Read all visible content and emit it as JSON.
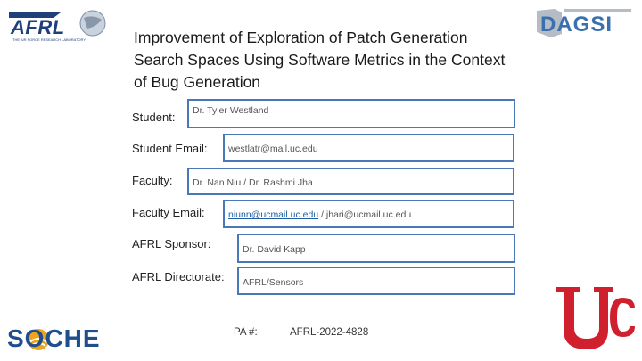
{
  "title": "Improvement of Exploration of Patch Generation Search Spaces Using Software Metrics in the Context of Bug Generation",
  "logos": {
    "afrl": "AFRL",
    "afrl_tagline": "THE AIR FORCE RESEARCH LABORATORY",
    "dagsi": "DAGSI",
    "soche": "SOCHE"
  },
  "fields": {
    "student_label": "Student:",
    "student_value": "Dr. Tyler Westland",
    "student_email_label": "Student Email:",
    "student_email_value": "westlatr@mail.uc.edu",
    "faculty_label": "Faculty:",
    "faculty_value": "Dr. Nan Niu / Dr. Rashmi Jha",
    "faculty_email_label": "Faculty Email:",
    "faculty_email_link": "niunn@ucmail.uc.edu",
    "faculty_email_rest": " / jhari@ucmail.uc.edu",
    "sponsor_label": "AFRL Sponsor:",
    "sponsor_value": "Dr. David Kapp",
    "directorate_label": "AFRL Directorate:",
    "directorate_value": "AFRL/Sensors"
  },
  "pa": {
    "label": "PA #:",
    "value": "AFRL-2022-4828"
  },
  "colors": {
    "box_border": "#4a77b8",
    "link": "#1f5fa8",
    "uc_red": "#d0202e",
    "soche_blue": "#1f4e8c",
    "dagsi_blue": "#3a6fb0"
  }
}
